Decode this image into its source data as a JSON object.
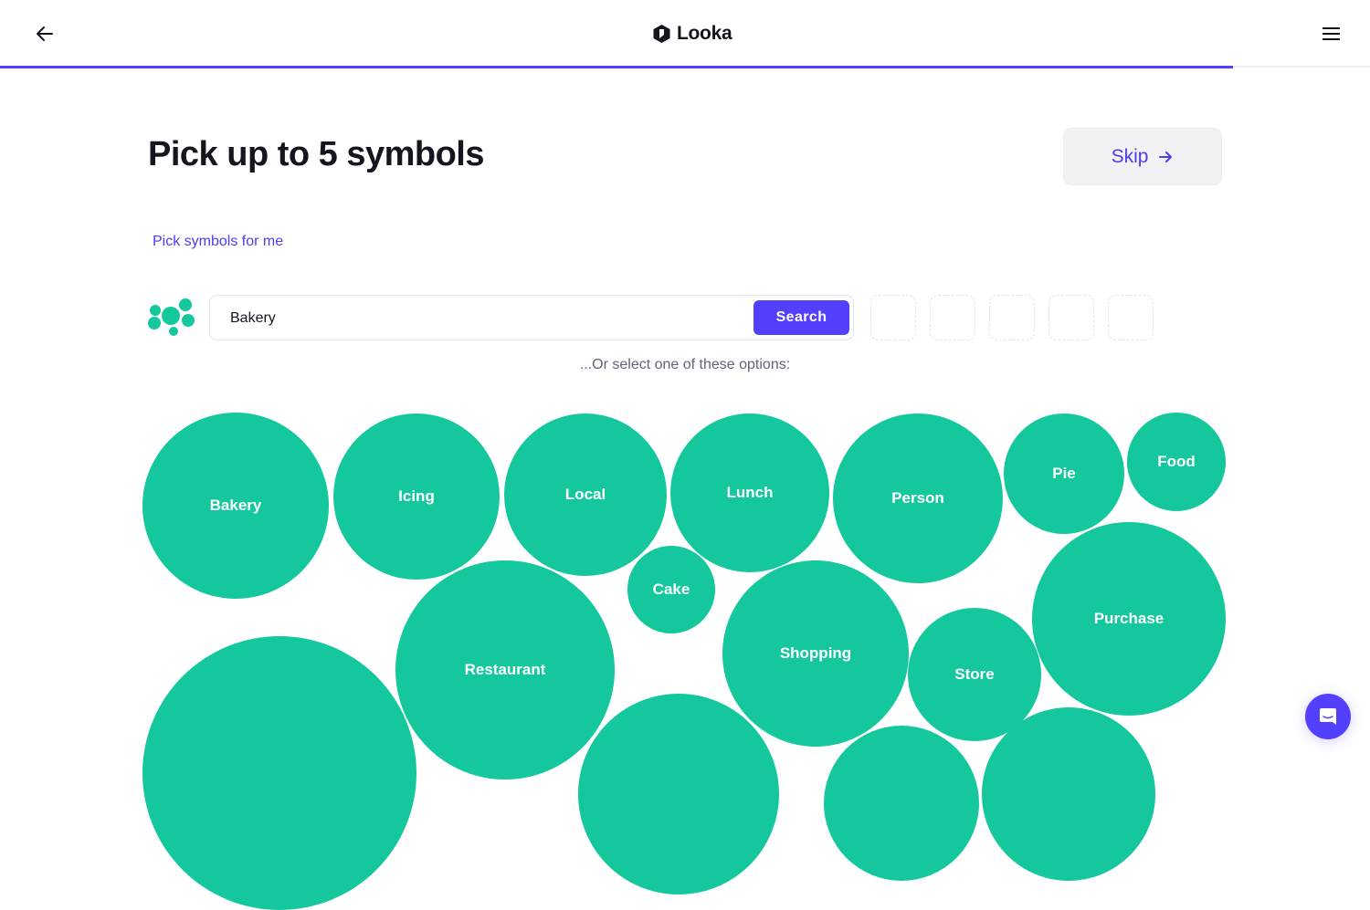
{
  "header": {
    "logo_text": "Looka",
    "back_icon": "arrow-left-icon",
    "menu_icon": "hamburger-menu-icon",
    "progress_percent": 90,
    "accent_color": "#5340ff"
  },
  "main": {
    "title": "Pick up to 5 symbols",
    "skip_label": "Skip",
    "skip_icon": "arrow-right-icon",
    "pick_for_me_label": "Pick symbols for me",
    "search": {
      "value": "Bakery",
      "placeholder": "",
      "button_label": "Search"
    },
    "selected_slots": 5,
    "options_prompt": "...Or select one of these options:",
    "bubble_color": "#14c79c",
    "options": [
      {
        "label": "Bakery"
      },
      {
        "label": "Icing"
      },
      {
        "label": "Local"
      },
      {
        "label": "Lunch"
      },
      {
        "label": "Person"
      },
      {
        "label": "Pie"
      },
      {
        "label": "Food"
      },
      {
        "label": "Cake"
      },
      {
        "label": "Restaurant"
      },
      {
        "label": "Shopping"
      },
      {
        "label": "Store"
      },
      {
        "label": "Purchase"
      },
      {
        "label": ""
      },
      {
        "label": ""
      },
      {
        "label": ""
      },
      {
        "label": ""
      }
    ]
  },
  "chat": {
    "icon": "chat-bubble-icon"
  }
}
